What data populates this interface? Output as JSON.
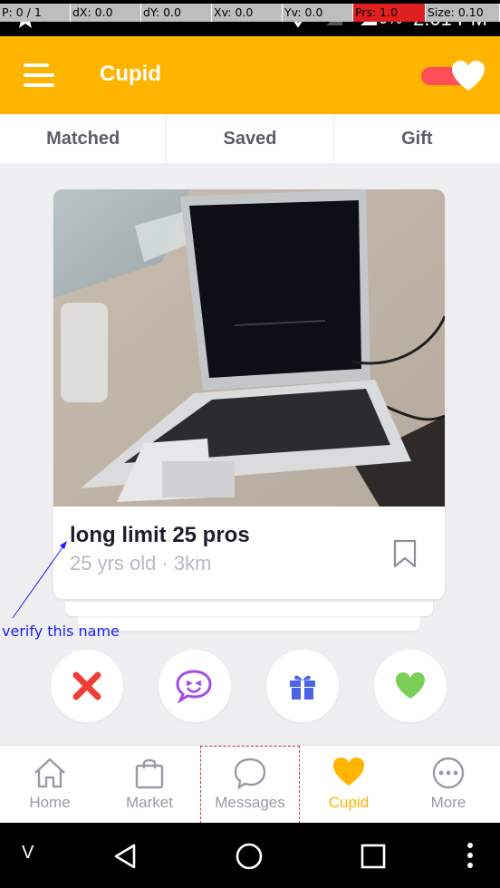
{
  "statusbar": {
    "debug": [
      "P: 0 / 1",
      "dX: 0.0",
      "dY: 0.0",
      "Xv: 0.0",
      "Yv: 0.0",
      "Prs: 1.0",
      "Size: 0.10"
    ],
    "battery": "70%",
    "time": "2:01 PM"
  },
  "header": {
    "title": "Cupid",
    "accent": "#ffb400",
    "toggle_color": "#ff4d5a"
  },
  "tabs": [
    {
      "label": "Matched"
    },
    {
      "label": "Saved"
    },
    {
      "label": "Gift"
    }
  ],
  "card": {
    "name": "long limit 25 pros",
    "subtitle": "25 yrs old · 3km"
  },
  "annotation": {
    "text": "verify this name"
  },
  "actions": [
    {
      "icon": "close-icon",
      "color": "#ef3e36"
    },
    {
      "icon": "chat-wink-icon",
      "color": "#a44be6"
    },
    {
      "icon": "gift-icon",
      "color": "#4a63e8"
    },
    {
      "icon": "heart-icon",
      "color": "#7bcf57"
    }
  ],
  "bottom_nav": [
    {
      "label": "Home",
      "icon": "home-icon"
    },
    {
      "label": "Market",
      "icon": "shopping-bag-icon"
    },
    {
      "label": "Messages",
      "icon": "message-bubble-icon"
    },
    {
      "label": "Cupid",
      "icon": "heart-icon",
      "active": true
    },
    {
      "label": "More",
      "icon": "more-dots-icon"
    }
  ],
  "sysnav": {
    "v_label": "V"
  }
}
